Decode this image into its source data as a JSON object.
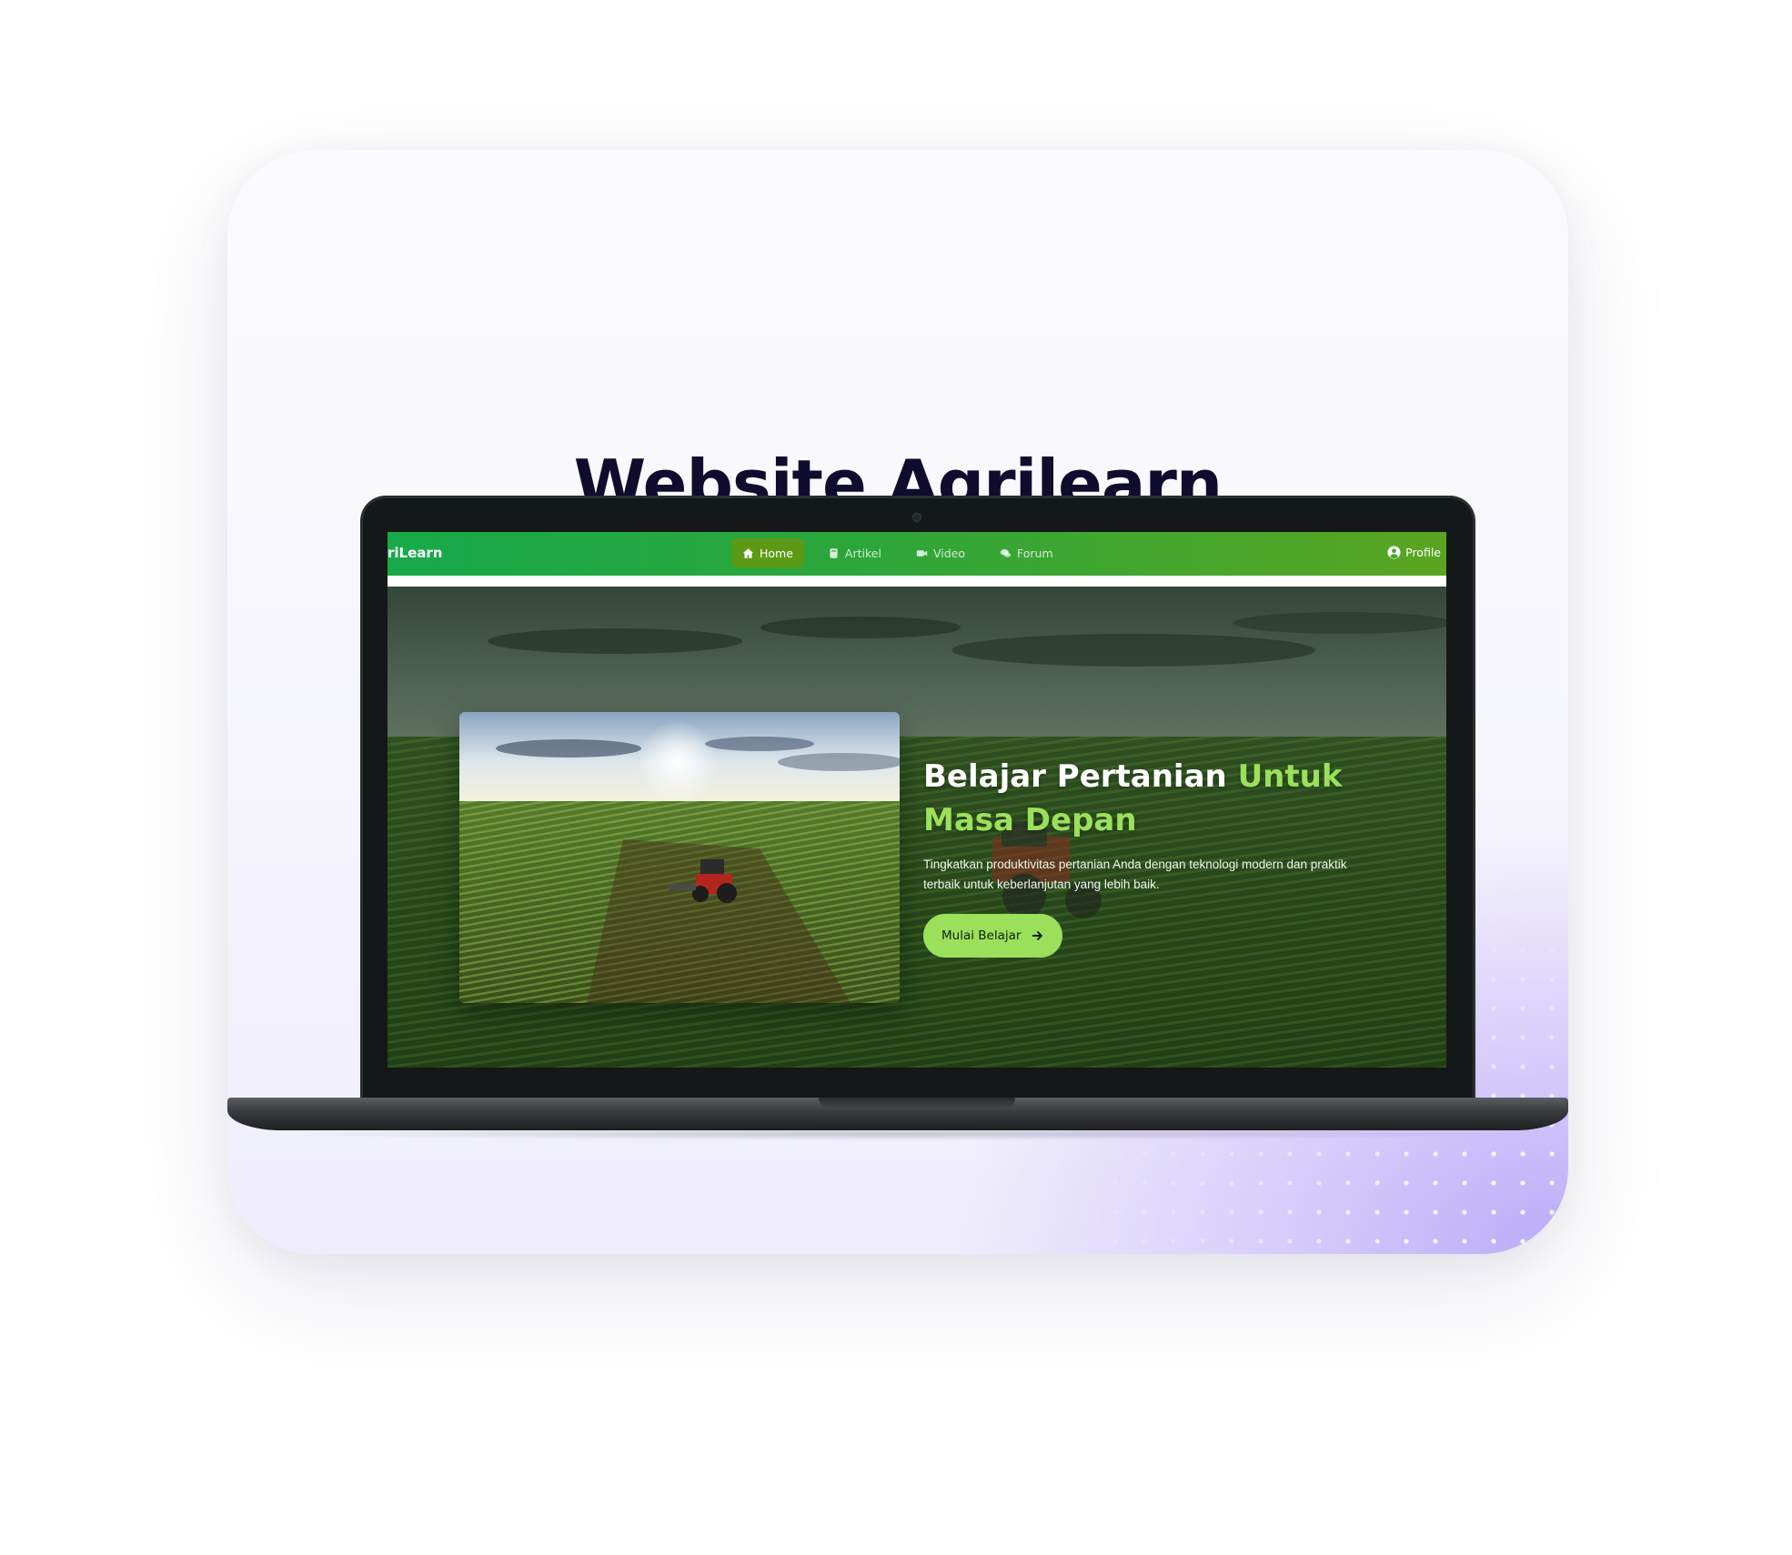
{
  "card": {
    "title": "Website Agrilearn"
  },
  "site": {
    "brand": "riLearn",
    "nav": [
      {
        "label": "Home",
        "icon": "home-icon",
        "active": true
      },
      {
        "label": "Artikel",
        "icon": "book-icon",
        "active": false
      },
      {
        "label": "Video",
        "icon": "video-camera-icon",
        "active": false
      },
      {
        "label": "Forum",
        "icon": "chat-bubbles-icon",
        "active": false
      }
    ],
    "profile": {
      "label": "Profile",
      "icon": "user-circle-icon"
    }
  },
  "hero": {
    "title_part1": "Belajar Pertanian ",
    "title_highlight": "Untuk Masa Depan",
    "subtitle": "Tingkatkan produktivitas pertanian Anda dengan teknologi modern dan praktik terbaik untuk keberlanjutan yang lebih baik.",
    "cta_label": "Mulai Belajar",
    "cta_icon": "arrow-right-icon"
  },
  "colors": {
    "nav_start": "#17a94a",
    "nav_end": "#5aa521",
    "accent_green": "#9be05a",
    "title_dark": "#0f0c2e"
  }
}
